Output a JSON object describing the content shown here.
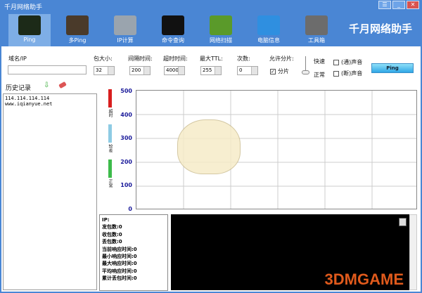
{
  "window": {
    "title": "千月网络助手",
    "brand": "千月网络助手",
    "controls": [
      "☰",
      "_",
      "✕"
    ]
  },
  "toolbar": [
    {
      "label": "Ping",
      "icon": "ping-monitor-icon",
      "color": "#1c2a18"
    },
    {
      "label": "多Ping",
      "icon": "multi-ping-chart-icon",
      "color": "#4a3a2a"
    },
    {
      "label": "IP计算",
      "icon": "calculator-icon",
      "color": "#9aa4ae"
    },
    {
      "label": "命令查询",
      "icon": "terminal-icon",
      "color": "#111"
    },
    {
      "label": "网络扫描",
      "icon": "network-scan-icon",
      "color": "#5a9a2a"
    },
    {
      "label": "电脑信息",
      "icon": "computer-monitor-icon",
      "color": "#2f8fe0"
    },
    {
      "label": "工具箱",
      "icon": "tools-icon",
      "color": "#6c6c6c"
    }
  ],
  "form": {
    "domain_label": "域名/IP",
    "domain_value": "",
    "size_label": "包大小:",
    "size_value": "32",
    "interval_label": "间隔时间:",
    "interval_value": "200",
    "timeout_label": "超时时间:",
    "timeout_value": "4000",
    "ttl_label": "最大TTL:",
    "ttl_value": "255",
    "count_label": "次数:",
    "count_value": "0",
    "frag_label": "允许分片:",
    "frag_check": "分片",
    "fast": "快速",
    "normal": "正常",
    "sound1": "(通)声音",
    "sound2": "(断)声音",
    "ping_button": "Ping"
  },
  "history": {
    "title": "历史记录",
    "items": [
      "114.114.114.114",
      "www.iqianyue.net"
    ]
  },
  "chart_data": {
    "type": "line",
    "ylim": [
      0,
      500
    ],
    "yticks": [
      "500",
      "400",
      "300",
      "200",
      "100",
      "0"
    ],
    "legend": [
      {
        "label": "超时",
        "color": "#d81e1e"
      },
      {
        "label": "较差",
        "color": "#8ecbe4"
      },
      {
        "label": "正常",
        "color": "#3dbb4a"
      }
    ],
    "series": []
  },
  "stats": [
    "IP:",
    "发包数:0",
    "收包数:0",
    "丢包数:0",
    "当前响应时间:0",
    "最小响应时间:0",
    "最大响应时间:0",
    "平均响应时间:0",
    "累计丢包时间:0"
  ],
  "watermark": "3DMGAME"
}
